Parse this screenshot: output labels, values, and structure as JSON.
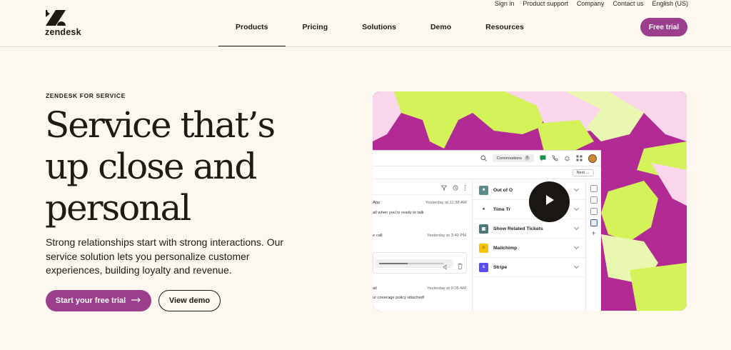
{
  "utility_nav": [
    "Sign in",
    "Product support",
    "Company",
    "Contact us",
    "English (US)"
  ],
  "brand": {
    "name": "zendesk"
  },
  "nav": {
    "items": [
      "Products",
      "Pricing",
      "Solutions",
      "Demo",
      "Resources"
    ],
    "active": "Products",
    "cta": "Free trial"
  },
  "hero": {
    "eyebrow": "ZENDESK FOR SERVICE",
    "headline_lines": [
      "Service that’s",
      "up close and",
      "personal"
    ],
    "subcopy": "Strong relationships start with strong interactions. Our service solution lets you personalize customer experiences, building loyalty and revenue.",
    "primary_cta": "Start your free trial",
    "secondary_cta": "View demo"
  },
  "media": {
    "app": {
      "conversations_label": "Conversations",
      "conversations_count": "0",
      "next_label": "Next",
      "messages": [
        {
          "source": "App",
          "time": "Yesterday at 11:38 AM",
          "text": "all when you're ready to talk"
        },
        {
          "source": "e call",
          "time": "Yesterday at 3:40 PM",
          "text": ""
        },
        {
          "source": "ail",
          "time": "Yesterday at 9:05 AM",
          "text": "ur coverage policy attached!"
        }
      ],
      "apps": [
        {
          "label": "Out of O",
          "icon": "out-of-office-icon",
          "color": "#5a8a8a"
        },
        {
          "label": "Time Tr",
          "icon": "time-tracking-icon",
          "color": "#333333"
        },
        {
          "label": "Show Related Tickets",
          "icon": "related-tickets-icon",
          "color": "#4c7a7a"
        },
        {
          "label": "Mailchimp",
          "icon": "mailchimp-icon",
          "color": "#f5c400"
        },
        {
          "label": "Stripe",
          "icon": "stripe-icon",
          "color": "#5b4bf5"
        }
      ]
    },
    "play_icon": "play-icon"
  },
  "colors": {
    "background": "#fdf8ef",
    "brand_purple": "#9b3f8c",
    "magenta": "#b22b95",
    "lime": "#d4f25a"
  }
}
